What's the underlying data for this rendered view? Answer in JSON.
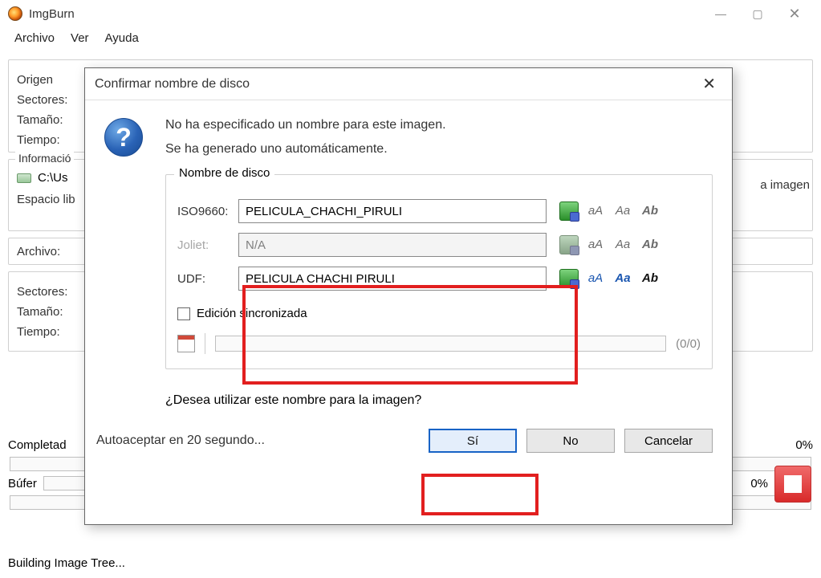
{
  "window": {
    "title": "ImgBurn",
    "menu": {
      "archivo": "Archivo",
      "ver": "Ver",
      "ayuda": "Ayuda"
    }
  },
  "main": {
    "group1": {
      "origen": "Origen",
      "sectores": "Sectores:",
      "tamano": "Tamaño:",
      "tiempo": "Tiempo:"
    },
    "right_label": "a imagen",
    "group2_label": "Informació",
    "drive_path": "C:\\Us",
    "espacio": "Espacio lib",
    "archivo_label": "Archivo:",
    "sectores": "Sectores:",
    "tamano": "Tamaño:",
    "tiempo": "Tiempo:",
    "completado": "Completad",
    "bufer": "Búfer",
    "pct0": "0%",
    "pct0b": "0%",
    "status": "Building Image Tree..."
  },
  "dialog": {
    "title": "Confirmar nombre de disco",
    "line1": "No ha especificado un nombre para este imagen.",
    "line2": "Se ha generado uno automáticamente.",
    "group_title": "Nombre de disco",
    "iso_label": "ISO9660:",
    "iso_value": "PELICULA_CHACHI_PIRULI",
    "joliet_label": "Joliet:",
    "joliet_value": "N/A",
    "udf_label": "UDF:",
    "udf_value": "PELICULA CHACHI PIRULI",
    "sync": "Edición sincronizada",
    "progress_count": "(0/0)",
    "question": "¿Desea utilizar este nombre para la imagen?",
    "auto": "Autoaceptar en 20 segundo...",
    "yes": "Sí",
    "no": "No",
    "cancel": "Cancelar",
    "tool_aA": "aA",
    "tool_Aa": "Aa",
    "tool_Ab": "Ab"
  }
}
